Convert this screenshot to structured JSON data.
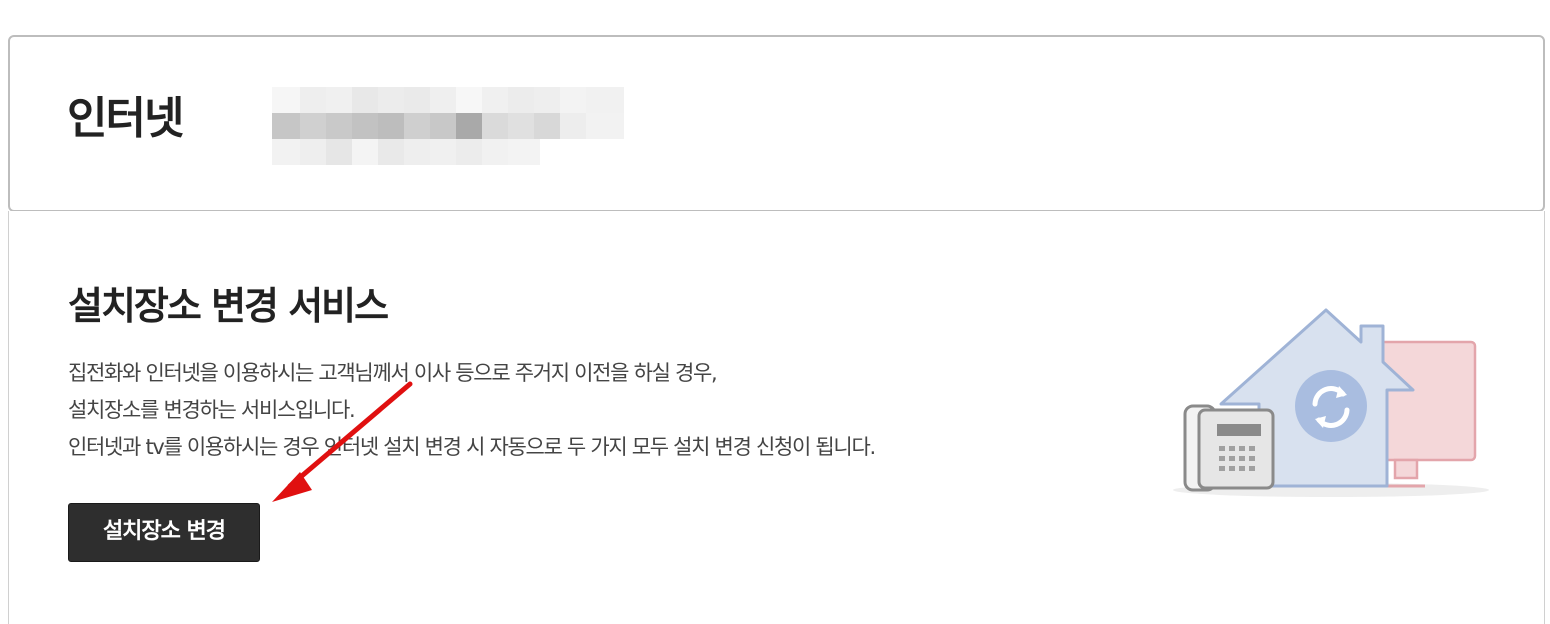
{
  "header": {
    "title": "인터넷",
    "masked_info": ""
  },
  "service": {
    "title": "설치장소 변경 서비스",
    "description_lines": [
      "집전화와 인터넷을 이용하시는 고객님께서 이사 등으로 주거지 이전을 하실 경우,",
      "설치장소를 변경하는 서비스입니다.",
      "인터넷과 tv를 이용하시는 경우 인터넷 설치 변경 시 자동으로 두 가지 모두 설치 변경 신청이 됩니다."
    ],
    "button_label": "설치장소 변경"
  },
  "icons": {
    "illustration": "house-phone-monitor-refresh-illustration",
    "annotation": "red-arrow-annotation"
  },
  "colors": {
    "button_bg": "#2e2e2e",
    "button_text": "#ffffff",
    "house_fill": "#d8e1ef",
    "house_stroke": "#9fb3d6",
    "refresh_circle": "#a9bde0",
    "monitor_fill": "#f4d7d9",
    "monitor_stroke": "#e3a5ab",
    "phone_fill": "#e6e6e6",
    "phone_stroke": "#8a8a8a",
    "annotation_arrow": "#e01010"
  }
}
